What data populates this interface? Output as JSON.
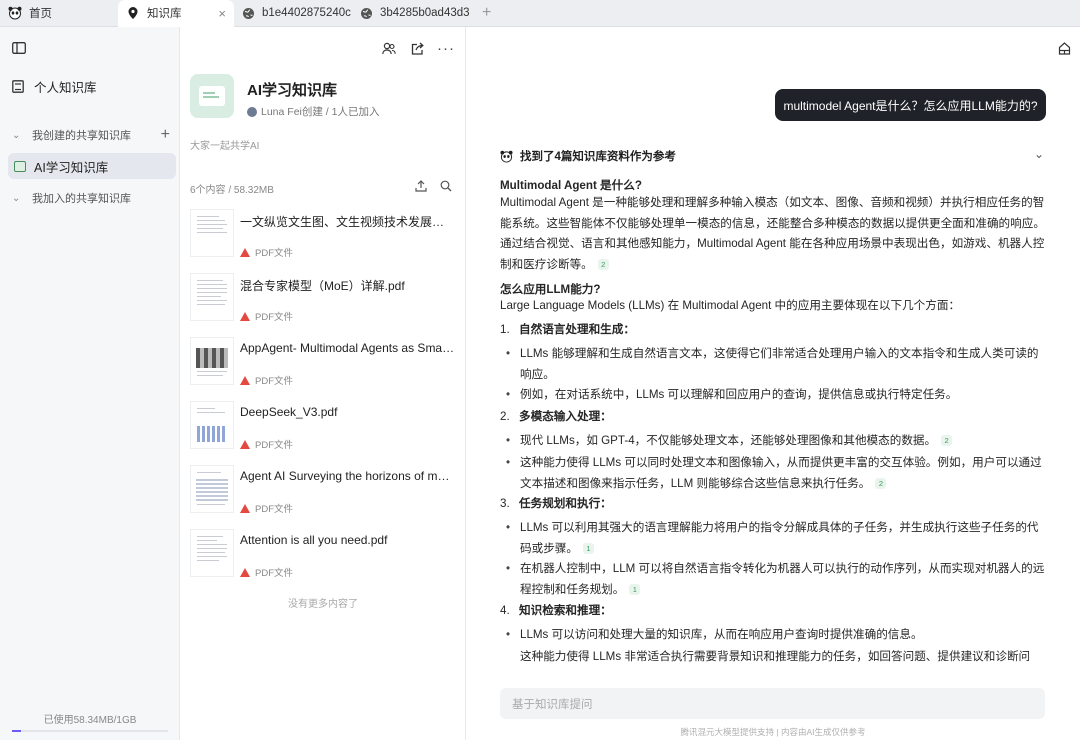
{
  "tabs": [
    {
      "label": "首页",
      "icon": "panda-icon"
    },
    {
      "label": "知识库",
      "icon": "location-pin-icon",
      "active": true
    },
    {
      "label": "b1e4402875240c",
      "icon": "globe-icon"
    },
    {
      "label": "3b4285b0ad43d3",
      "icon": "globe-icon"
    }
  ],
  "new_tab": "+",
  "sidebar": {
    "personal": "个人知识库",
    "my_shared": "我创建的共享知识库",
    "active_kb": "AI学习知识库",
    "joined": "我加入的共享知识库",
    "storage": "已使用58.34MB/1GB",
    "storage_fraction": 0.057
  },
  "kb": {
    "title": "AI学习知识库",
    "meta": "Luna Fei创建 / 1人已加入",
    "desc": "大家一起共学AI",
    "count": "6个内容 / 58.32MB",
    "no_more": "没有更多内容了",
    "files": [
      {
        "name": "一文纵览文生图、文生视频技术发展路径...",
        "type": "PDF文件"
      },
      {
        "name": "混合专家模型（MoE）详解.pdf",
        "type": "PDF文件"
      },
      {
        "name": "AppAgent- Multimodal Agents as Smart...",
        "type": "PDF文件"
      },
      {
        "name": "DeepSeek_V3.pdf",
        "type": "PDF文件"
      },
      {
        "name": "Agent AI Surveying the horizons of muti...",
        "type": "PDF文件"
      },
      {
        "name": "Attention is all you need.pdf",
        "type": "PDF文件"
      }
    ]
  },
  "chat": {
    "question": "multimodel Agent是什么？怎么应用LLM能力的?",
    "refs_header": "找到了4篇知识库资料作为参考",
    "h1": "Multimodal Agent 是什么?",
    "p1": "Multimodal Agent 是一种能够处理和理解多种输入模态（如文本、图像、音频和视频）并执行相应任务的智能系统。这些智能体不仅能够处理单一模态的信息，还能整合多种模态的数据以提供更全面和准确的响应。通过结合视觉、语言和其他感知能力，Multimodal Agent 能在各种应用场景中表现出色，如游戏、机器人控制和医疗诊断等。",
    "p1_ref": "2",
    "h2": "怎么应用LLM能力?",
    "p2": "Large Language Models (LLMs) 在 Multimodal Agent 中的应用主要体现在以下几个方面：",
    "s1_num": "1.",
    "s1": "自然语言处理和生成：",
    "s1_b1": "LLMs 能够理解和生成自然语言文本，这使得它们非常适合处理用户输入的文本指令和生成人类可读的响应。",
    "s1_b2": "例如，在对话系统中，LLMs 可以理解和回应用户的查询，提供信息或执行特定任务。",
    "s2_num": "2.",
    "s2": "多模态输入处理：",
    "s2_b1": "现代 LLMs，如 GPT-4，不仅能够处理文本，还能够处理图像和其他模态的数据。",
    "s2_b1_ref": "2",
    "s2_b2": "这种能力使得 LLMs 可以同时处理文本和图像输入，从而提供更丰富的交互体验。例如，用户可以通过文本描述和图像来指示任务，LLM 则能够综合这些信息来执行任务。",
    "s2_b2_ref": "2",
    "s3_num": "3.",
    "s3": "任务规划和执行：",
    "s3_b1": "LLMs 可以利用其强大的语言理解能力将用户的指令分解成具体的子任务，并生成执行这些子任务的代码或步骤。",
    "s3_b1_ref": "1",
    "s3_b2": "在机器人控制中，LLM 可以将自然语言指令转化为机器人可以执行的动作序列，从而实现对机器人的远程控制和任务规划。",
    "s3_b2_ref": "1",
    "s4_num": "4.",
    "s4": "知识检索和推理：",
    "s4_b1": "LLMs 可以访问和处理大量的知识库，从而在响应用户查询时提供准确的信息。",
    "s4_b2": "这种能力使得 LLMs 非常适合执行需要背景知识和推理能力的任务，如回答问题、提供建议和诊断问",
    "input_placeholder": "基于知识库提问",
    "footer": "腾讯混元大模型提供支持 | 内容由AI生成仅供参考"
  },
  "colors": {
    "accent_green": "#3a9a5c",
    "pdf_red": "#e5483f",
    "bubble": "#1f2329",
    "storage_bar": "#6b5cf6"
  }
}
